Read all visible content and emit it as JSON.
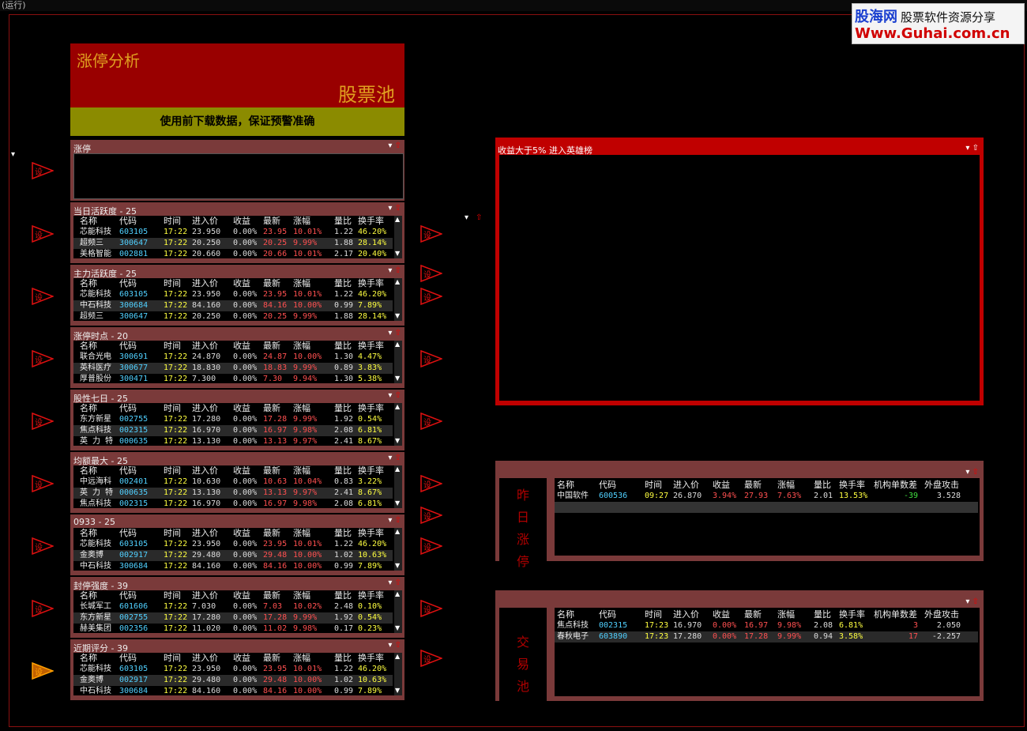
{
  "window": {
    "title": "(运行)"
  },
  "logo": {
    "line1_brand": "股海网",
    "line1_tagline": "股票软件资源分享",
    "line2": "Www.Guhai.com.cn"
  },
  "header": {
    "title": "涨停分析",
    "subtitle": "股票池"
  },
  "notice": "使用前下载数据，保证预警准确",
  "columns": [
    "名称",
    "代码",
    "时间",
    "进入价",
    "收益",
    "最新",
    "涨幅",
    "量比",
    "换手率"
  ],
  "panels": [
    {
      "title": "涨停",
      "rows": []
    },
    {
      "title": "当日活跃度 - 25",
      "rows": [
        [
          "芯能科技",
          "603105",
          "17:22",
          "23.950",
          "0.00%",
          "23.95",
          "10.01%",
          "1.22",
          "46.20%"
        ],
        [
          "超频三",
          "300647",
          "17:22",
          "20.250",
          "0.00%",
          "20.25",
          "9.99%",
          "1.88",
          "28.14%"
        ],
        [
          "美格智能",
          "002881",
          "17:22",
          "20.660",
          "0.00%",
          "20.66",
          "10.01%",
          "2.17",
          "20.40%"
        ]
      ]
    },
    {
      "title": "主力活跃度 - 25",
      "rows": [
        [
          "芯能科技",
          "603105",
          "17:22",
          "23.950",
          "0.00%",
          "23.95",
          "10.01%",
          "1.22",
          "46.20%"
        ],
        [
          "中石科技",
          "300684",
          "17:22",
          "84.160",
          "0.00%",
          "84.16",
          "10.00%",
          "0.99",
          "7.89%"
        ],
        [
          "超频三",
          "300647",
          "17:22",
          "20.250",
          "0.00%",
          "20.25",
          "9.99%",
          "1.88",
          "28.14%"
        ]
      ]
    },
    {
      "title": "涨停时点 - 20",
      "rows": [
        [
          "联合光电",
          "300691",
          "17:22",
          "24.870",
          "0.00%",
          "24.87",
          "10.00%",
          "1.30",
          "4.47%"
        ],
        [
          "英科医疗",
          "300677",
          "17:22",
          "18.830",
          "0.00%",
          "18.83",
          "9.99%",
          "0.89",
          "3.83%"
        ],
        [
          "厚普股份",
          "300471",
          "17:22",
          "7.300",
          "0.00%",
          "7.30",
          "9.94%",
          "1.30",
          "5.38%"
        ]
      ]
    },
    {
      "title": "股性七日 - 25",
      "rows": [
        [
          "东方新星",
          "002755",
          "17:22",
          "17.280",
          "0.00%",
          "17.28",
          "9.99%",
          "1.92",
          "0.54%"
        ],
        [
          "焦点科技",
          "002315",
          "17:22",
          "16.970",
          "0.00%",
          "16.97",
          "9.98%",
          "2.08",
          "6.81%"
        ],
        [
          "英 力 特",
          "000635",
          "17:22",
          "13.130",
          "0.00%",
          "13.13",
          "9.97%",
          "2.41",
          "8.67%"
        ]
      ]
    },
    {
      "title": "均额最大 - 25",
      "rows": [
        [
          "中远海科",
          "002401",
          "17:22",
          "10.630",
          "0.00%",
          "10.63",
          "10.04%",
          "0.83",
          "3.22%"
        ],
        [
          "英 力 特",
          "000635",
          "17:22",
          "13.130",
          "0.00%",
          "13.13",
          "9.97%",
          "2.41",
          "8.67%"
        ],
        [
          "焦点科技",
          "002315",
          "17:22",
          "16.970",
          "0.00%",
          "16.97",
          "9.98%",
          "2.08",
          "6.81%"
        ]
      ]
    },
    {
      "title": "0933 - 25",
      "rows": [
        [
          "芯能科技",
          "603105",
          "17:22",
          "23.950",
          "0.00%",
          "23.95",
          "10.01%",
          "1.22",
          "46.20%"
        ],
        [
          "金奥博",
          "002917",
          "17:22",
          "29.480",
          "0.00%",
          "29.48",
          "10.00%",
          "1.02",
          "10.63%"
        ],
        [
          "中石科技",
          "300684",
          "17:22",
          "84.160",
          "0.00%",
          "84.16",
          "10.00%",
          "0.99",
          "7.89%"
        ]
      ]
    },
    {
      "title": "封停强度 - 39",
      "rows": [
        [
          "长城军工",
          "601606",
          "17:22",
          "7.030",
          "0.00%",
          "7.03",
          "10.02%",
          "2.48",
          "0.10%"
        ],
        [
          "东方新星",
          "002755",
          "17:22",
          "17.280",
          "0.00%",
          "17.28",
          "9.99%",
          "1.92",
          "0.54%"
        ],
        [
          "赫美集团",
          "002356",
          "17:22",
          "11.020",
          "0.00%",
          "11.02",
          "9.98%",
          "0.17",
          "0.23%"
        ]
      ]
    },
    {
      "title": "近期评分 - 39",
      "rows": [
        [
          "芯能科技",
          "603105",
          "17:22",
          "23.950",
          "0.00%",
          "23.95",
          "10.01%",
          "1.22",
          "46.20%"
        ],
        [
          "金奥博",
          "002917",
          "17:22",
          "29.480",
          "0.00%",
          "29.48",
          "10.00%",
          "1.02",
          "10.63%"
        ],
        [
          "中石科技",
          "300684",
          "17:22",
          "84.160",
          "0.00%",
          "84.16",
          "10.00%",
          "0.99",
          "7.89%"
        ]
      ]
    }
  ],
  "arrow_label": "设",
  "hero": {
    "title": "收益大于5%  进入英雄榜"
  },
  "right_columns": [
    "名称",
    "代码",
    "时间",
    "进入价",
    "收益",
    "最新",
    "涨幅",
    "量比",
    "换手率",
    "机构单数差",
    "外盘攻击"
  ],
  "yesterday": {
    "side_label": [
      "昨",
      "日",
      "涨",
      "停"
    ],
    "rows": [
      [
        "中国软件",
        "600536",
        "09:27",
        "26.870",
        "3.94%",
        "27.93",
        "7.63%",
        "2.01",
        "13.53%",
        "-39",
        "3.528"
      ]
    ]
  },
  "trade_pool": {
    "side_label": [
      "交",
      "易",
      "池"
    ],
    "rows": [
      [
        "焦点科技",
        "002315",
        "17:23",
        "16.970",
        "0.00%",
        "16.97",
        "9.98%",
        "2.08",
        "6.81%",
        "3",
        "2.050"
      ],
      [
        "春秋电子",
        "603890",
        "17:23",
        "17.280",
        "0.00%",
        "17.28",
        "9.99%",
        "0.94",
        "3.58%",
        "17",
        "-2.257"
      ]
    ]
  },
  "icons": {
    "menu": "dropdown-icon",
    "up": "arrow-up-icon"
  }
}
